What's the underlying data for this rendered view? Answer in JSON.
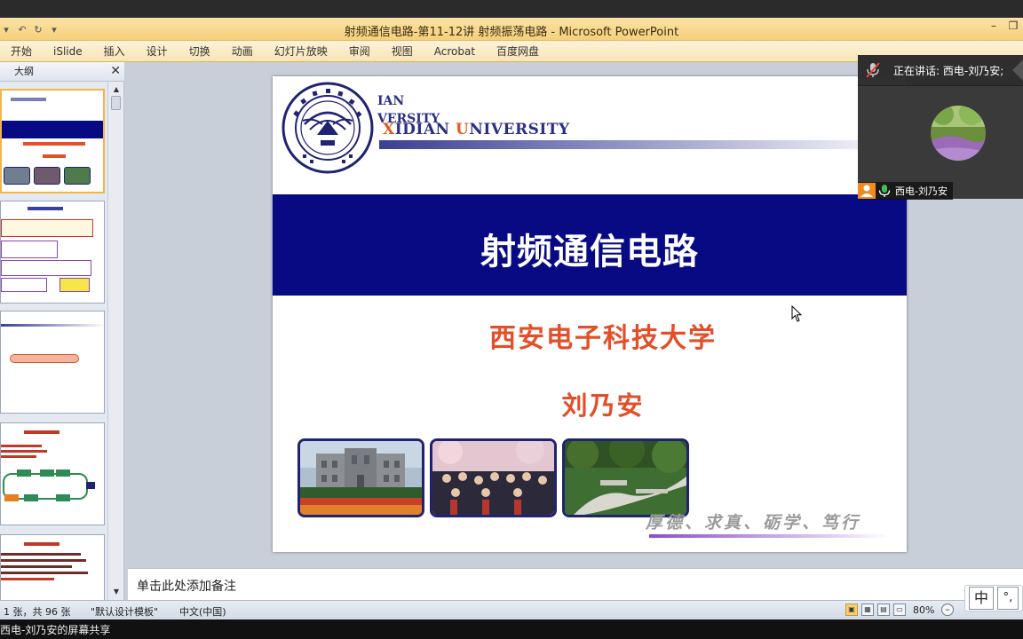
{
  "window": {
    "title": "射频通信电路-第11-12讲 射频振荡电路 - Microsoft PowerPoint"
  },
  "ribbon": {
    "tabs": [
      "开始",
      "iSlide",
      "插入",
      "设计",
      "切换",
      "动画",
      "幻灯片放映",
      "审阅",
      "视图",
      "Acrobat",
      "百度网盘"
    ]
  },
  "outline": {
    "tab_label": "大纲"
  },
  "slide": {
    "uni_line1": "IAN",
    "uni_line2": "VERSITY",
    "uni_name_x": "X",
    "uni_name_rest1": "IDIAN ",
    "uni_name_u": "U",
    "uni_name_rest2": "NIVERSITY",
    "title": "射频通信电路",
    "school": "西安电子科技大学",
    "author": "刘乃安",
    "motto": "厚德、求真、砺学、笃行",
    "colors": {
      "banner": "#070a82",
      "title_text": "#e24f28",
      "accent_orange": "#e25b1c"
    }
  },
  "notes": {
    "placeholder": "单击此处添加备注"
  },
  "status": {
    "slide_info": "1 张，共 96 张",
    "theme": "\"默认设计模板\"",
    "language": "中文(中国)",
    "zoom": "80%"
  },
  "ime": {
    "mode": "中",
    "punct": "°,"
  },
  "meeting": {
    "speaking_label": "正在讲话: 西电-刘乃安;",
    "tile_name": "西电-刘乃安",
    "share_label": "西电-刘乃安的屏幕共享"
  }
}
